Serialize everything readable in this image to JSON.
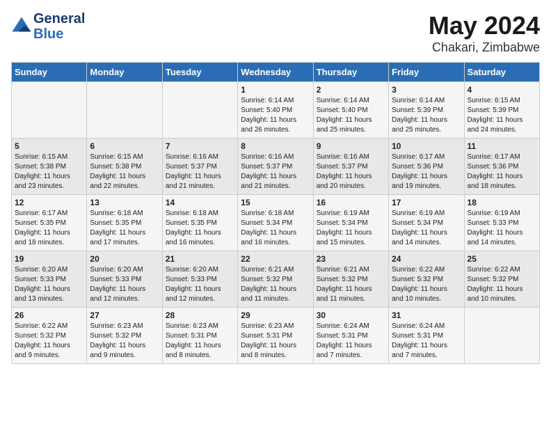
{
  "header": {
    "logo_line1": "General",
    "logo_line2": "Blue",
    "title": "May 2024",
    "subtitle": "Chakari, Zimbabwe"
  },
  "days_of_week": [
    "Sunday",
    "Monday",
    "Tuesday",
    "Wednesday",
    "Thursday",
    "Friday",
    "Saturday"
  ],
  "weeks": [
    [
      {
        "day": "",
        "info": ""
      },
      {
        "day": "",
        "info": ""
      },
      {
        "day": "",
        "info": ""
      },
      {
        "day": "1",
        "info": "Sunrise: 6:14 AM\nSunset: 5:40 PM\nDaylight: 11 hours\nand 26 minutes."
      },
      {
        "day": "2",
        "info": "Sunrise: 6:14 AM\nSunset: 5:40 PM\nDaylight: 11 hours\nand 25 minutes."
      },
      {
        "day": "3",
        "info": "Sunrise: 6:14 AM\nSunset: 5:39 PM\nDaylight: 11 hours\nand 25 minutes."
      },
      {
        "day": "4",
        "info": "Sunrise: 6:15 AM\nSunset: 5:39 PM\nDaylight: 11 hours\nand 24 minutes."
      }
    ],
    [
      {
        "day": "5",
        "info": "Sunrise: 6:15 AM\nSunset: 5:38 PM\nDaylight: 11 hours\nand 23 minutes."
      },
      {
        "day": "6",
        "info": "Sunrise: 6:15 AM\nSunset: 5:38 PM\nDaylight: 11 hours\nand 22 minutes."
      },
      {
        "day": "7",
        "info": "Sunrise: 6:16 AM\nSunset: 5:37 PM\nDaylight: 11 hours\nand 21 minutes."
      },
      {
        "day": "8",
        "info": "Sunrise: 6:16 AM\nSunset: 5:37 PM\nDaylight: 11 hours\nand 21 minutes."
      },
      {
        "day": "9",
        "info": "Sunrise: 6:16 AM\nSunset: 5:37 PM\nDaylight: 11 hours\nand 20 minutes."
      },
      {
        "day": "10",
        "info": "Sunrise: 6:17 AM\nSunset: 5:36 PM\nDaylight: 11 hours\nand 19 minutes."
      },
      {
        "day": "11",
        "info": "Sunrise: 6:17 AM\nSunset: 5:36 PM\nDaylight: 11 hours\nand 18 minutes."
      }
    ],
    [
      {
        "day": "12",
        "info": "Sunrise: 6:17 AM\nSunset: 5:35 PM\nDaylight: 11 hours\nand 18 minutes."
      },
      {
        "day": "13",
        "info": "Sunrise: 6:18 AM\nSunset: 5:35 PM\nDaylight: 11 hours\nand 17 minutes."
      },
      {
        "day": "14",
        "info": "Sunrise: 6:18 AM\nSunset: 5:35 PM\nDaylight: 11 hours\nand 16 minutes."
      },
      {
        "day": "15",
        "info": "Sunrise: 6:18 AM\nSunset: 5:34 PM\nDaylight: 11 hours\nand 16 minutes."
      },
      {
        "day": "16",
        "info": "Sunrise: 6:19 AM\nSunset: 5:34 PM\nDaylight: 11 hours\nand 15 minutes."
      },
      {
        "day": "17",
        "info": "Sunrise: 6:19 AM\nSunset: 5:34 PM\nDaylight: 11 hours\nand 14 minutes."
      },
      {
        "day": "18",
        "info": "Sunrise: 6:19 AM\nSunset: 5:33 PM\nDaylight: 11 hours\nand 14 minutes."
      }
    ],
    [
      {
        "day": "19",
        "info": "Sunrise: 6:20 AM\nSunset: 5:33 PM\nDaylight: 11 hours\nand 13 minutes."
      },
      {
        "day": "20",
        "info": "Sunrise: 6:20 AM\nSunset: 5:33 PM\nDaylight: 11 hours\nand 12 minutes."
      },
      {
        "day": "21",
        "info": "Sunrise: 6:20 AM\nSunset: 5:33 PM\nDaylight: 11 hours\nand 12 minutes."
      },
      {
        "day": "22",
        "info": "Sunrise: 6:21 AM\nSunset: 5:32 PM\nDaylight: 11 hours\nand 11 minutes."
      },
      {
        "day": "23",
        "info": "Sunrise: 6:21 AM\nSunset: 5:32 PM\nDaylight: 11 hours\nand 11 minutes."
      },
      {
        "day": "24",
        "info": "Sunrise: 6:22 AM\nSunset: 5:32 PM\nDaylight: 11 hours\nand 10 minutes."
      },
      {
        "day": "25",
        "info": "Sunrise: 6:22 AM\nSunset: 5:32 PM\nDaylight: 11 hours\nand 10 minutes."
      }
    ],
    [
      {
        "day": "26",
        "info": "Sunrise: 6:22 AM\nSunset: 5:32 PM\nDaylight: 11 hours\nand 9 minutes."
      },
      {
        "day": "27",
        "info": "Sunrise: 6:23 AM\nSunset: 5:32 PM\nDaylight: 11 hours\nand 9 minutes."
      },
      {
        "day": "28",
        "info": "Sunrise: 6:23 AM\nSunset: 5:31 PM\nDaylight: 11 hours\nand 8 minutes."
      },
      {
        "day": "29",
        "info": "Sunrise: 6:23 AM\nSunset: 5:31 PM\nDaylight: 11 hours\nand 8 minutes."
      },
      {
        "day": "30",
        "info": "Sunrise: 6:24 AM\nSunset: 5:31 PM\nDaylight: 11 hours\nand 7 minutes."
      },
      {
        "day": "31",
        "info": "Sunrise: 6:24 AM\nSunset: 5:31 PM\nDaylight: 11 hours\nand 7 minutes."
      },
      {
        "day": "",
        "info": ""
      }
    ]
  ]
}
